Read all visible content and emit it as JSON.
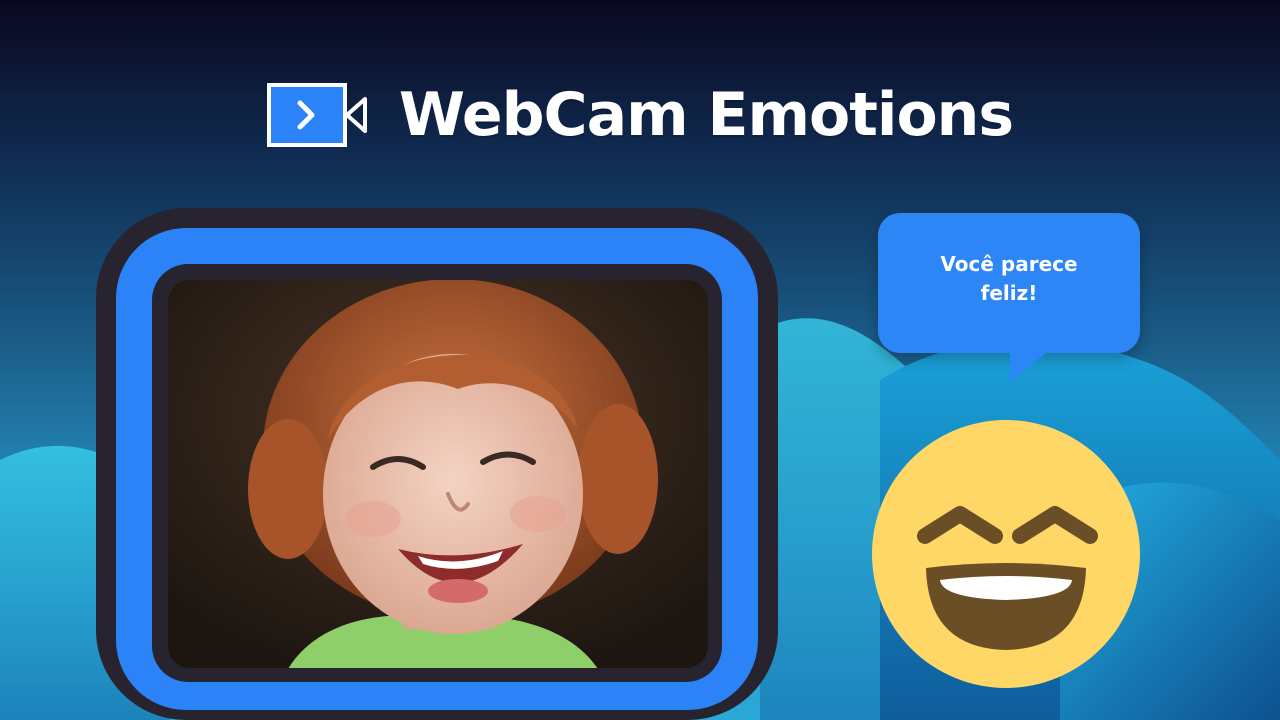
{
  "app": {
    "title": "WebCam Emotions",
    "logo_icon": "video-camera-icon"
  },
  "webcam": {
    "feed_description_icon": "webcam-feed"
  },
  "result": {
    "message": "Você parece feliz!",
    "emoji_icon": "grinning-squinting-face-icon"
  },
  "colors": {
    "accent_blue": "#2b83f7",
    "frame_dark": "#27242f",
    "emoji_yellow": "#ffd766",
    "emoji_features": "#6a4f26"
  }
}
